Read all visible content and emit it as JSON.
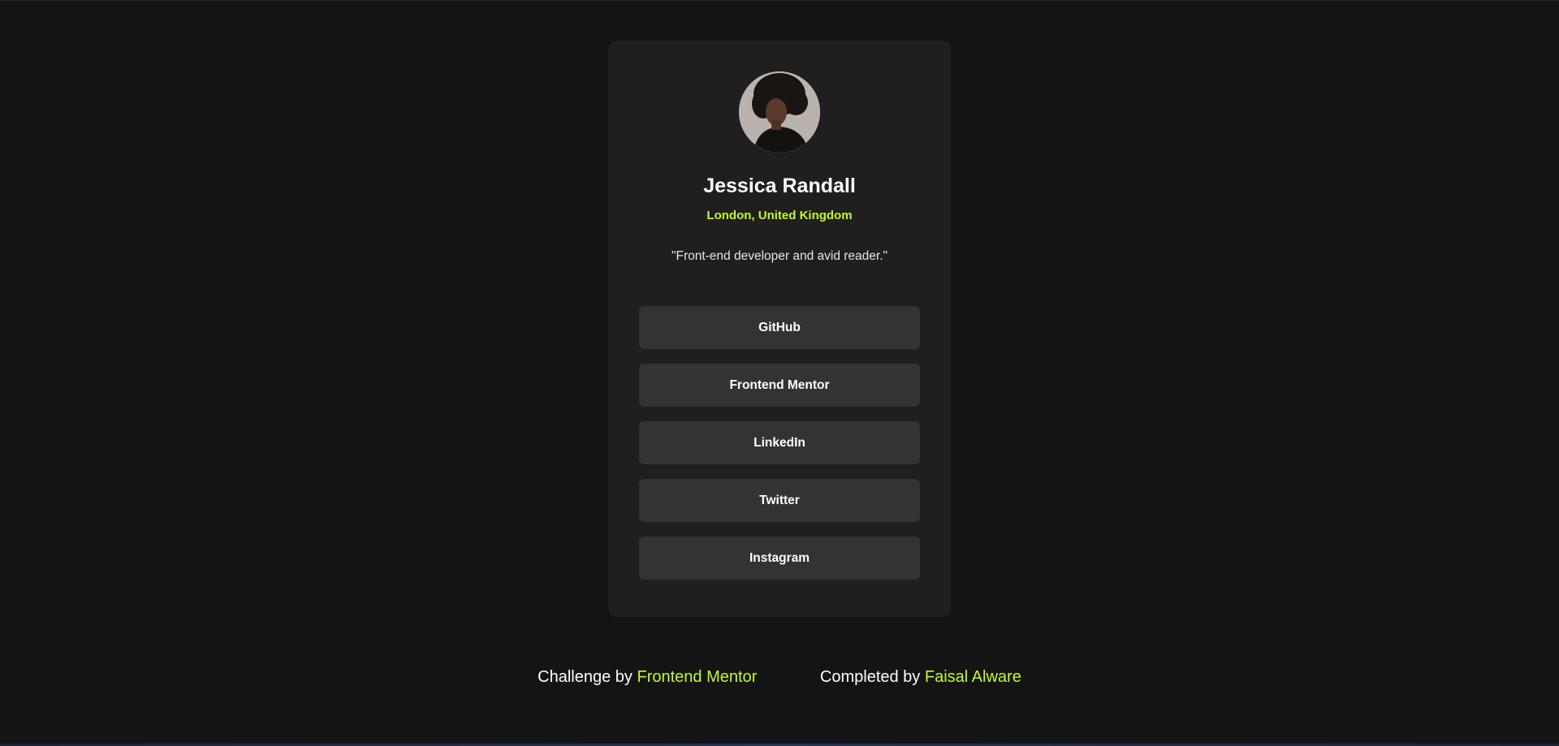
{
  "profile": {
    "name": "Jessica Randall",
    "location": "London, United Kingdom",
    "bio": "\"Front-end developer and avid reader.\""
  },
  "links": [
    {
      "label": "GitHub"
    },
    {
      "label": "Frontend Mentor"
    },
    {
      "label": "LinkedIn"
    },
    {
      "label": "Twitter"
    },
    {
      "label": "Instagram"
    }
  ],
  "footer": {
    "challenge_prefix": "Challenge by",
    "challenge_link": "Frontend Mentor",
    "completed_prefix": "Completed by",
    "completed_link": "Faisal Alware"
  },
  "colors": {
    "background": "#141414",
    "card": "#1f1f1f",
    "button": "#333333",
    "accent": "#c4f82a",
    "text": "#ffffff"
  }
}
